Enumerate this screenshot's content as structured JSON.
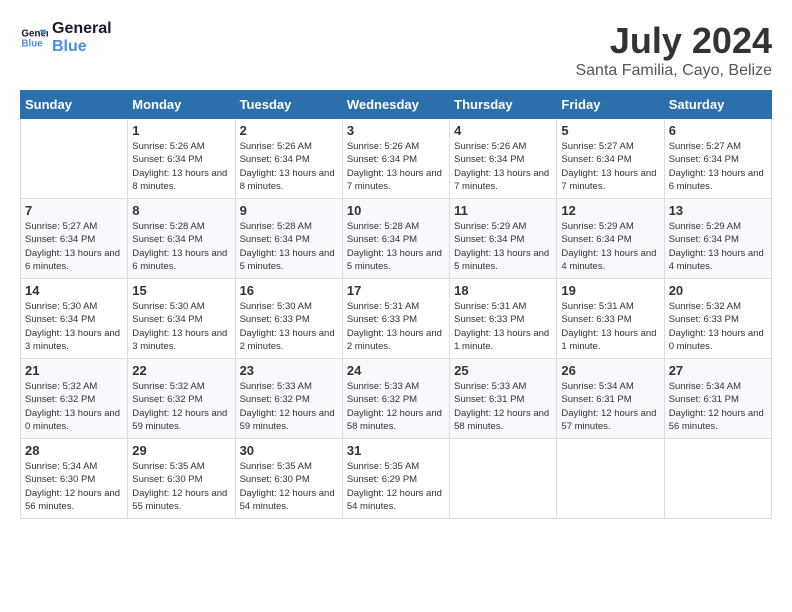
{
  "header": {
    "logo_line1": "General",
    "logo_line2": "Blue",
    "month": "July 2024",
    "location": "Santa Familia, Cayo, Belize"
  },
  "days_of_week": [
    "Sunday",
    "Monday",
    "Tuesday",
    "Wednesday",
    "Thursday",
    "Friday",
    "Saturday"
  ],
  "weeks": [
    [
      {
        "day": "",
        "info": ""
      },
      {
        "day": "1",
        "info": "Sunrise: 5:26 AM\nSunset: 6:34 PM\nDaylight: 13 hours\nand 8 minutes."
      },
      {
        "day": "2",
        "info": "Sunrise: 5:26 AM\nSunset: 6:34 PM\nDaylight: 13 hours\nand 8 minutes."
      },
      {
        "day": "3",
        "info": "Sunrise: 5:26 AM\nSunset: 6:34 PM\nDaylight: 13 hours\nand 7 minutes."
      },
      {
        "day": "4",
        "info": "Sunrise: 5:26 AM\nSunset: 6:34 PM\nDaylight: 13 hours\nand 7 minutes."
      },
      {
        "day": "5",
        "info": "Sunrise: 5:27 AM\nSunset: 6:34 PM\nDaylight: 13 hours\nand 7 minutes."
      },
      {
        "day": "6",
        "info": "Sunrise: 5:27 AM\nSunset: 6:34 PM\nDaylight: 13 hours\nand 6 minutes."
      }
    ],
    [
      {
        "day": "7",
        "info": "Sunrise: 5:27 AM\nSunset: 6:34 PM\nDaylight: 13 hours\nand 6 minutes."
      },
      {
        "day": "8",
        "info": "Sunrise: 5:28 AM\nSunset: 6:34 PM\nDaylight: 13 hours\nand 6 minutes."
      },
      {
        "day": "9",
        "info": "Sunrise: 5:28 AM\nSunset: 6:34 PM\nDaylight: 13 hours\nand 5 minutes."
      },
      {
        "day": "10",
        "info": "Sunrise: 5:28 AM\nSunset: 6:34 PM\nDaylight: 13 hours\nand 5 minutes."
      },
      {
        "day": "11",
        "info": "Sunrise: 5:29 AM\nSunset: 6:34 PM\nDaylight: 13 hours\nand 5 minutes."
      },
      {
        "day": "12",
        "info": "Sunrise: 5:29 AM\nSunset: 6:34 PM\nDaylight: 13 hours\nand 4 minutes."
      },
      {
        "day": "13",
        "info": "Sunrise: 5:29 AM\nSunset: 6:34 PM\nDaylight: 13 hours\nand 4 minutes."
      }
    ],
    [
      {
        "day": "14",
        "info": "Sunrise: 5:30 AM\nSunset: 6:34 PM\nDaylight: 13 hours\nand 3 minutes."
      },
      {
        "day": "15",
        "info": "Sunrise: 5:30 AM\nSunset: 6:34 PM\nDaylight: 13 hours\nand 3 minutes."
      },
      {
        "day": "16",
        "info": "Sunrise: 5:30 AM\nSunset: 6:33 PM\nDaylight: 13 hours\nand 2 minutes."
      },
      {
        "day": "17",
        "info": "Sunrise: 5:31 AM\nSunset: 6:33 PM\nDaylight: 13 hours\nand 2 minutes."
      },
      {
        "day": "18",
        "info": "Sunrise: 5:31 AM\nSunset: 6:33 PM\nDaylight: 13 hours\nand 1 minute."
      },
      {
        "day": "19",
        "info": "Sunrise: 5:31 AM\nSunset: 6:33 PM\nDaylight: 13 hours\nand 1 minute."
      },
      {
        "day": "20",
        "info": "Sunrise: 5:32 AM\nSunset: 6:33 PM\nDaylight: 13 hours\nand 0 minutes."
      }
    ],
    [
      {
        "day": "21",
        "info": "Sunrise: 5:32 AM\nSunset: 6:32 PM\nDaylight: 13 hours\nand 0 minutes."
      },
      {
        "day": "22",
        "info": "Sunrise: 5:32 AM\nSunset: 6:32 PM\nDaylight: 12 hours\nand 59 minutes."
      },
      {
        "day": "23",
        "info": "Sunrise: 5:33 AM\nSunset: 6:32 PM\nDaylight: 12 hours\nand 59 minutes."
      },
      {
        "day": "24",
        "info": "Sunrise: 5:33 AM\nSunset: 6:32 PM\nDaylight: 12 hours\nand 58 minutes."
      },
      {
        "day": "25",
        "info": "Sunrise: 5:33 AM\nSunset: 6:31 PM\nDaylight: 12 hours\nand 58 minutes."
      },
      {
        "day": "26",
        "info": "Sunrise: 5:34 AM\nSunset: 6:31 PM\nDaylight: 12 hours\nand 57 minutes."
      },
      {
        "day": "27",
        "info": "Sunrise: 5:34 AM\nSunset: 6:31 PM\nDaylight: 12 hours\nand 56 minutes."
      }
    ],
    [
      {
        "day": "28",
        "info": "Sunrise: 5:34 AM\nSunset: 6:30 PM\nDaylight: 12 hours\nand 56 minutes."
      },
      {
        "day": "29",
        "info": "Sunrise: 5:35 AM\nSunset: 6:30 PM\nDaylight: 12 hours\nand 55 minutes."
      },
      {
        "day": "30",
        "info": "Sunrise: 5:35 AM\nSunset: 6:30 PM\nDaylight: 12 hours\nand 54 minutes."
      },
      {
        "day": "31",
        "info": "Sunrise: 5:35 AM\nSunset: 6:29 PM\nDaylight: 12 hours\nand 54 minutes."
      },
      {
        "day": "",
        "info": ""
      },
      {
        "day": "",
        "info": ""
      },
      {
        "day": "",
        "info": ""
      }
    ]
  ]
}
